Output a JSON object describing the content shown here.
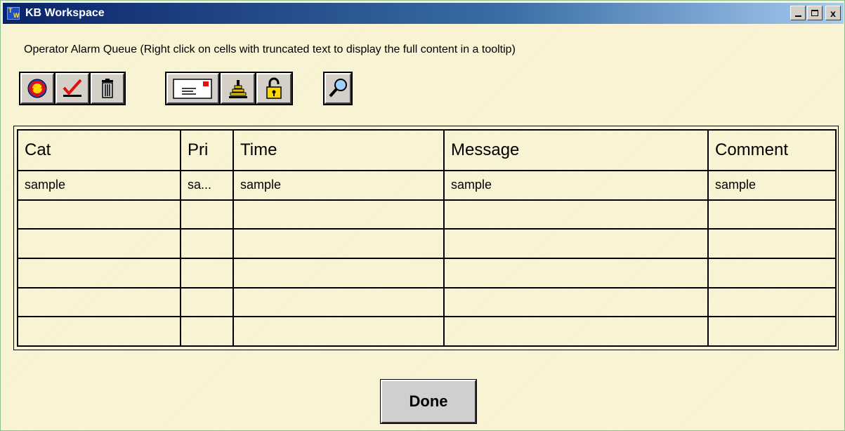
{
  "window": {
    "title": "KB Workspace",
    "app_icon_letters": [
      "T",
      "W"
    ],
    "controls": {
      "minimize": "minimize-button",
      "maximize": "maximize-button",
      "close_glyph": "x"
    }
  },
  "caption": "Operator Alarm Queue (Right click on cells with truncated text to display the full content in a tooltip)",
  "toolbar": {
    "group1": [
      "acknowledge-refresh-icon",
      "check-sign-icon",
      "trash-icon"
    ],
    "group2": [
      "mail-icon",
      "stack-icon",
      "unlock-icon"
    ],
    "group3": [
      "magnifier-icon"
    ]
  },
  "table": {
    "columns": [
      "Cat",
      "Pri",
      "Time",
      "Message",
      "Comment"
    ],
    "rows": [
      [
        "sample",
        "sa...",
        "sample",
        "sample",
        "sample"
      ],
      [
        "",
        "",
        "",
        "",
        ""
      ],
      [
        "",
        "",
        "",
        "",
        ""
      ],
      [
        "",
        "",
        "",
        "",
        ""
      ],
      [
        "",
        "",
        "",
        "",
        ""
      ],
      [
        "",
        "",
        "",
        "",
        ""
      ]
    ]
  },
  "done_label": "Done",
  "colors": {
    "background": "#f8f2cf",
    "titlebar_start": "#0a246a",
    "titlebar_end": "#a6caf0",
    "button_face": "#d4d0c8"
  }
}
